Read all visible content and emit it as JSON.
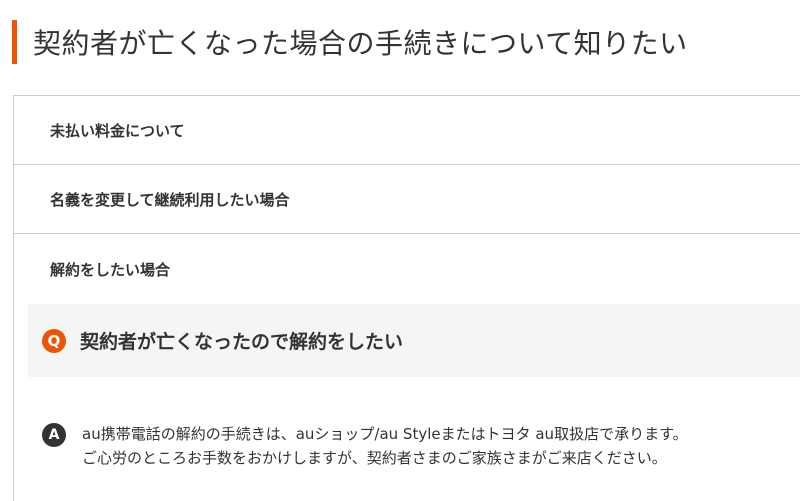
{
  "page": {
    "title": "契約者が亡くなった場合の手続きについて知りたい",
    "accent_color": "#eb5505"
  },
  "accordion": {
    "items": [
      {
        "label": "未払い料金について"
      },
      {
        "label": "名義を変更して継続利用したい場合"
      },
      {
        "label": "解約をしたい場合"
      }
    ]
  },
  "qa": {
    "question_badge": "Q",
    "question": "契約者が亡くなったので解約をしたい",
    "answer_badge": "A",
    "answer_lines": [
      "au携帯電話の解約の手続きは、auショップ/au Styleまたはトヨタ au取扱店で承ります。",
      "ご心労のところお手数をおかけしますが、契約者さまのご家族さまがご来店ください。"
    ]
  }
}
